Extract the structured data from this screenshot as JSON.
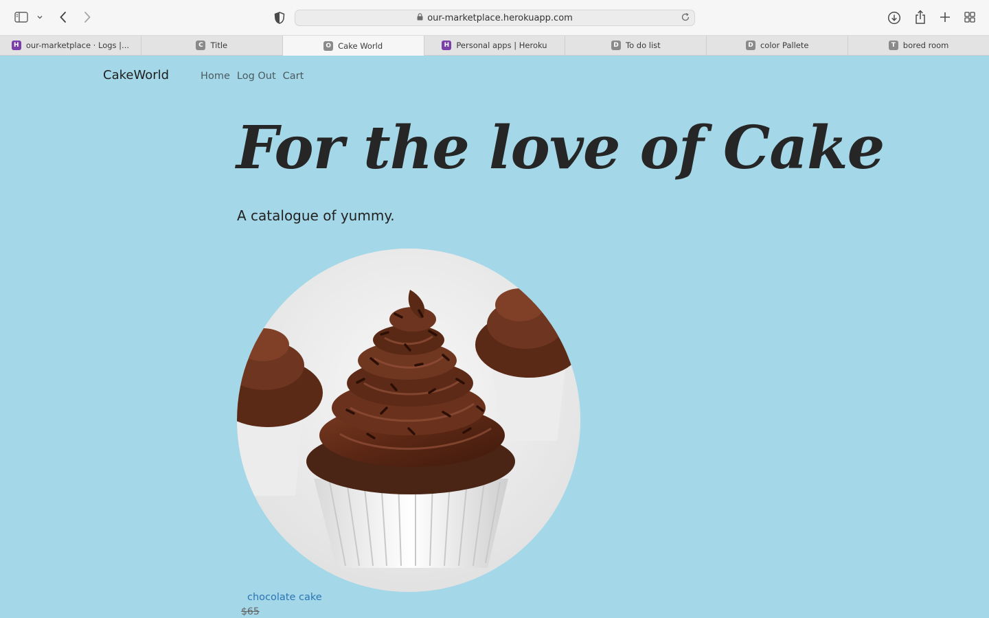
{
  "browser": {
    "url": "our-marketplace.herokuapp.com",
    "tabs": [
      {
        "label": "our-marketplace · Logs |...",
        "favicon_letter": "H",
        "favicon_color": "#7a3fa8"
      },
      {
        "label": "Title",
        "favicon_letter": "C",
        "favicon_color": "#8a8a8a"
      },
      {
        "label": "Cake World",
        "favicon_letter": "O",
        "favicon_color": "#8a8a8a",
        "active": true
      },
      {
        "label": "Personal apps | Heroku",
        "favicon_letter": "H",
        "favicon_color": "#7a3fa8"
      },
      {
        "label": "To do list",
        "favicon_letter": "D",
        "favicon_color": "#8a8a8a"
      },
      {
        "label": "color Pallete",
        "favicon_letter": "D",
        "favicon_color": "#8a8a8a"
      },
      {
        "label": "bored room",
        "favicon_letter": "T",
        "favicon_color": "#8a8a8a"
      }
    ]
  },
  "site": {
    "brand": "CakeWorld",
    "nav": {
      "home": "Home",
      "logout": "Log Out",
      "cart": "Cart"
    },
    "hero_title": "For the love of Cake",
    "hero_subtitle": "A catalogue of yummy.",
    "background_color": "#a4d7e7"
  },
  "product": {
    "name": "chocolate cake",
    "price": "$65"
  }
}
